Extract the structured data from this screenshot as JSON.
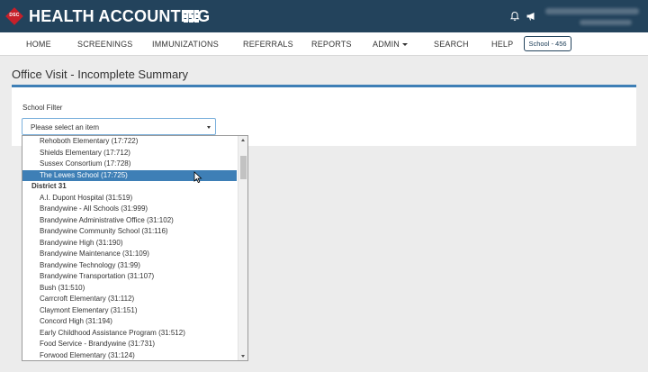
{
  "header": {
    "logo_text": "DSC",
    "app_title": "HEALTH ACCOUNTING",
    "icons": [
      "apps-grid-icon",
      "bell-icon",
      "megaphone-icon"
    ],
    "colors": {
      "topbar": "#23435c",
      "logo": "#c6202a",
      "accent": "#3e7fb6"
    }
  },
  "nav": {
    "items": [
      {
        "label": "HOME"
      },
      {
        "label": "SCREENINGS"
      },
      {
        "label": "IMMUNIZATIONS"
      },
      {
        "label": "REFERRALS"
      },
      {
        "label": "REPORTS"
      },
      {
        "label": "ADMIN"
      },
      {
        "label": "SEARCH"
      },
      {
        "label": "HELP"
      }
    ],
    "school_badge": "School - 456"
  },
  "page": {
    "title": "Office Visit - Incomplete Summary",
    "filter_label": "School Filter",
    "select_placeholder": "Please select an item"
  },
  "dropdown": {
    "items_before": [
      "Rehoboth Elementary (17:722)",
      "Shields Elementary (17:712)",
      "Sussex Consortium (17:728)"
    ],
    "selected": "The Lewes School (17:725)",
    "group": "District 31",
    "items_after": [
      "A.I. Dupont Hospital (31:519)",
      "Brandywine - All Schools (31:999)",
      "Brandywine Administrative Office (31:102)",
      "Brandywine Community School (31:116)",
      "Brandywine High (31:190)",
      "Brandywine Maintenance (31:109)",
      "Brandywine Technology (31:99)",
      "Brandywine Transportation (31:107)",
      "Bush (31:510)",
      "Carrcroft Elementary (31:112)",
      "Claymont Elementary (31:151)",
      "Concord High (31:194)",
      "Early Childhood Assistance Program (31:512)",
      "Food Service - Brandywine (31:731)",
      "Forwood Elementary (31:124)"
    ]
  }
}
